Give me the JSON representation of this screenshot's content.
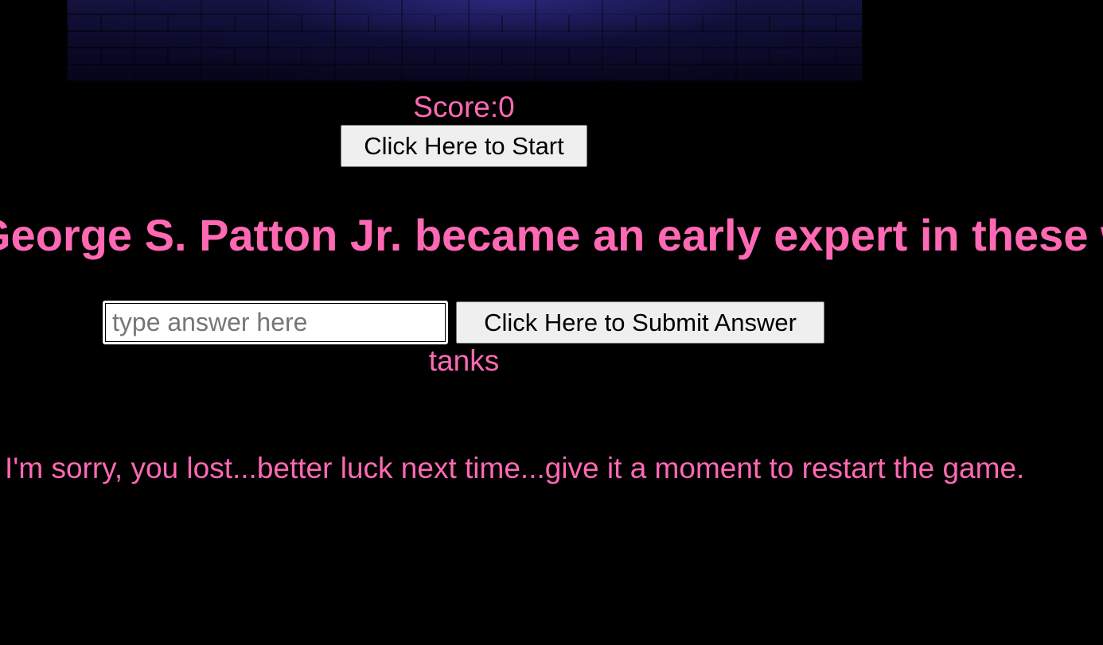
{
  "game": {
    "score_label": "Score:",
    "score_value": "0",
    "start_button": "Click Here to Start",
    "question": "George S. Patton Jr. became an early expert in these weapons",
    "answer_placeholder": "type answer here",
    "answer_value": "",
    "submit_button": "Click Here to Submit Answer",
    "correct_answer": "tanks",
    "status_message": "I'm sorry, you lost...better luck next time...give it a moment to restart the game."
  },
  "colors": {
    "background": "#000000",
    "text_accent": "#ff69b4",
    "button_face": "#efefef"
  }
}
